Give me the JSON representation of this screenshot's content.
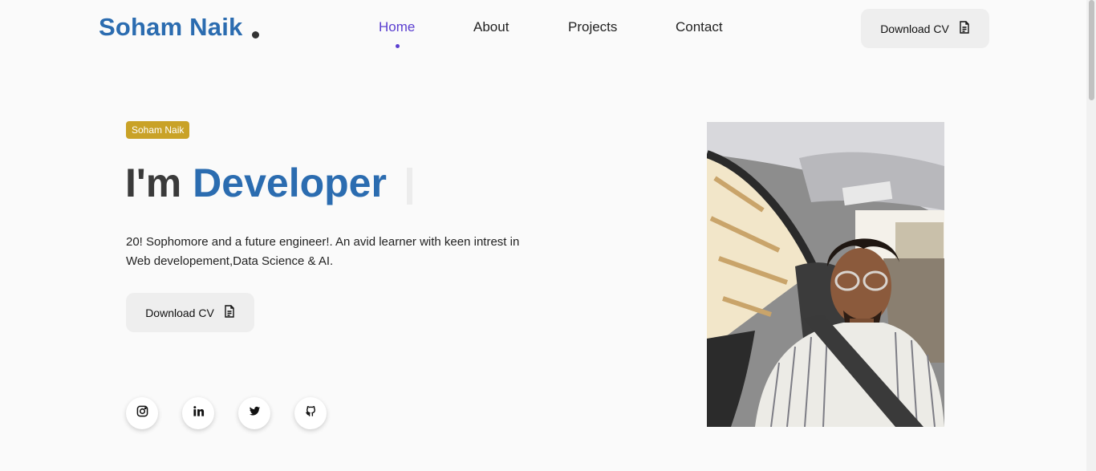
{
  "header": {
    "logo": "Soham Naik",
    "nav": [
      {
        "label": "Home",
        "active": true
      },
      {
        "label": "About",
        "active": false
      },
      {
        "label": "Projects",
        "active": false
      },
      {
        "label": "Contact",
        "active": false
      }
    ],
    "download_label": "Download CV"
  },
  "hero": {
    "badge": "Soham Naik",
    "headline_prefix": "I'm",
    "headline_highlight": "Developer",
    "description": "20! Sophomore and a future engineer!. An avid learner with keen intrest in Web developement,Data Science & AI.",
    "download_label": "Download CV",
    "socials": [
      {
        "icon": "instagram-icon"
      },
      {
        "icon": "linkedin-icon"
      },
      {
        "icon": "twitter-icon"
      },
      {
        "icon": "github-icon"
      }
    ]
  },
  "colors": {
    "brand": "#2b6cb0",
    "nav_active": "#5b3fd0",
    "badge": "#c9a227",
    "button_bg": "#eeeeee"
  }
}
